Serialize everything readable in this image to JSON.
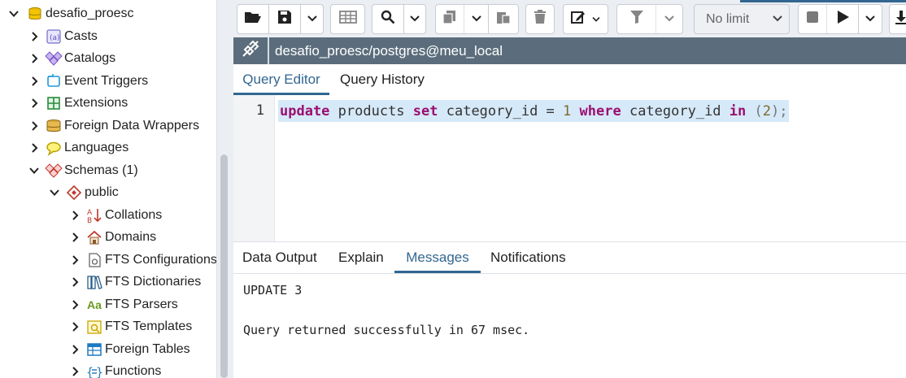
{
  "tree": {
    "root": {
      "label": "desafio_proesc",
      "icon": "database-icon",
      "expanded": true
    },
    "items": [
      {
        "label": "Casts",
        "icon": "casts-icon",
        "expanded": false
      },
      {
        "label": "Catalogs",
        "icon": "catalogs-icon",
        "expanded": false
      },
      {
        "label": "Event Triggers",
        "icon": "event-triggers-icon",
        "expanded": false
      },
      {
        "label": "Extensions",
        "icon": "extensions-icon",
        "expanded": false
      },
      {
        "label": "Foreign Data Wrappers",
        "icon": "foreign-data-wrappers-icon",
        "expanded": false
      },
      {
        "label": "Languages",
        "icon": "languages-icon",
        "expanded": false
      },
      {
        "label": "Schemas (1)",
        "icon": "schemas-icon",
        "expanded": true
      }
    ],
    "schema": {
      "label": "public",
      "icon": "schema-icon",
      "expanded": true
    },
    "schema_items": [
      {
        "label": "Collations",
        "icon": "collations-icon"
      },
      {
        "label": "Domains",
        "icon": "domains-icon"
      },
      {
        "label": "FTS Configurations",
        "icon": "fts-configurations-icon"
      },
      {
        "label": "FTS Dictionaries",
        "icon": "fts-dictionaries-icon"
      },
      {
        "label": "FTS Parsers",
        "icon": "fts-parsers-icon",
        "glyph": "Aa"
      },
      {
        "label": "FTS Templates",
        "icon": "fts-templates-icon"
      },
      {
        "label": "Foreign Tables",
        "icon": "foreign-tables-icon"
      },
      {
        "label": "Functions",
        "icon": "functions-icon"
      }
    ]
  },
  "toolbar": {
    "limit_select": "No limit",
    "icons": [
      "open-file-icon",
      "save-icon",
      "chevron-down-icon",
      "edit-data-icon",
      "search-icon",
      "chevron-down-icon",
      "copy-icon",
      "chevron-down-icon",
      "paste-icon",
      "delete-icon",
      "edit-icon",
      "filter-icon",
      "chevron-down-icon",
      "stop-icon",
      "execute-icon",
      "chevron-down-icon",
      "download-icon"
    ]
  },
  "connection": {
    "label": "desafio_proesc/postgres@meu_local",
    "icon": "disconnected-icon"
  },
  "editor_tabs": [
    {
      "label": "Query Editor",
      "active": true
    },
    {
      "label": "Query History",
      "active": false
    }
  ],
  "editor": {
    "line_number": "1",
    "code": {
      "t1": "update",
      "t2": " products ",
      "t3": "set",
      "t4": " category_id = ",
      "t5": "1",
      "t6": " ",
      "t7": "where",
      "t8": " category_id ",
      "t9": "in",
      "t10": " (",
      "t11": "2",
      "t12": ");"
    }
  },
  "output_tabs": [
    {
      "label": "Data Output",
      "active": false
    },
    {
      "label": "Explain",
      "active": false
    },
    {
      "label": "Messages",
      "active": true
    },
    {
      "label": "Notifications",
      "active": false
    }
  ],
  "messages": {
    "line1": "UPDATE 3",
    "line2": "Query returned successfully in 67 msec."
  },
  "colors": {
    "accent": "#326690",
    "connection_bar": "#5b6d7c",
    "keyword": "#9b0f70",
    "selection": "#d6e9f8"
  }
}
